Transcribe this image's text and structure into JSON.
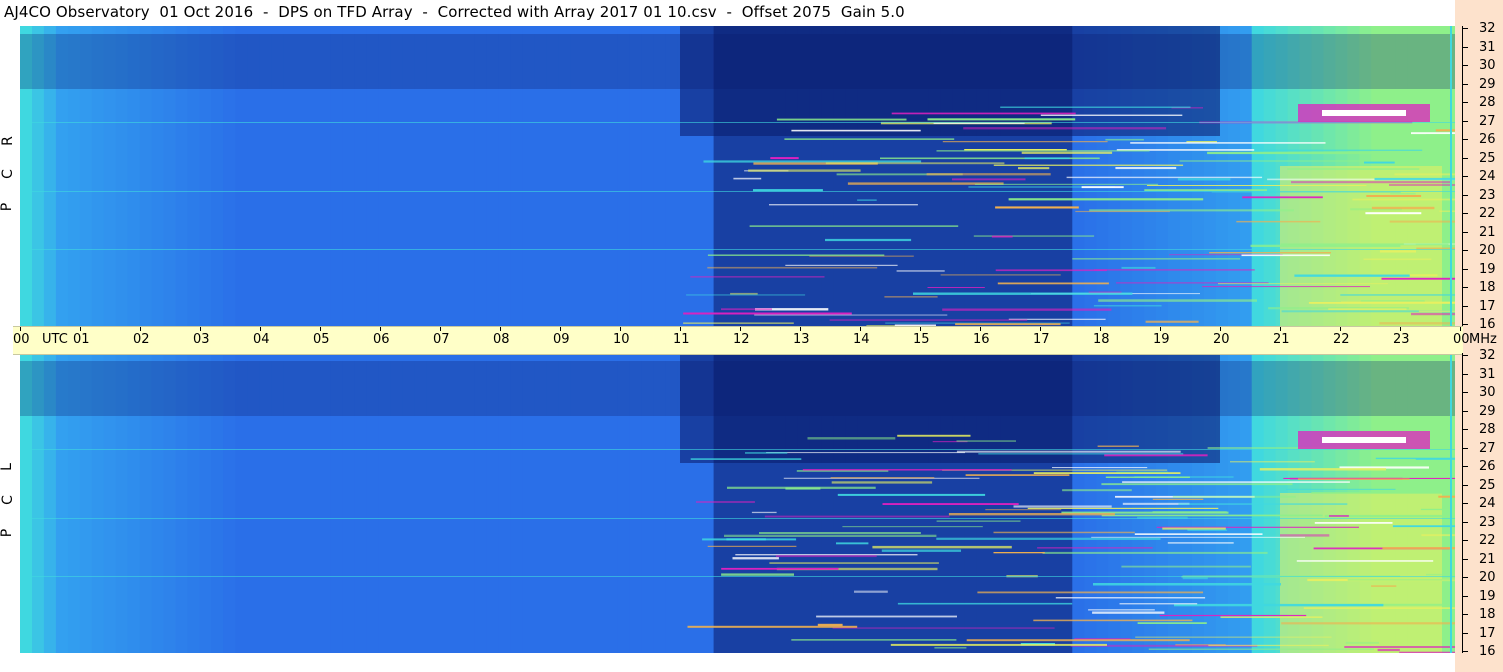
{
  "title": "AJ4CO Observatory  01 Oct 2016  -  DPS on TFD Array  -  Corrected with Array 2017 01 10.csv  -  Offset 2075  Gain 5.0",
  "panels": {
    "top_label": [
      "R",
      "C",
      "P"
    ],
    "bottom_label": [
      "L",
      "C",
      "P"
    ]
  },
  "time_axis": {
    "labels": [
      "00",
      "01",
      "02",
      "03",
      "04",
      "05",
      "06",
      "07",
      "08",
      "09",
      "10",
      "11",
      "12",
      "13",
      "14",
      "15",
      "16",
      "17",
      "18",
      "19",
      "20",
      "21",
      "22",
      "23",
      "00"
    ],
    "utc_label": "UTC",
    "mhz_label": "MHz"
  },
  "freq_axis": {
    "labels": [
      "32",
      "31",
      "30",
      "29",
      "28",
      "27",
      "26",
      "25",
      "24",
      "23",
      "22",
      "21",
      "20",
      "19",
      "18",
      "17",
      "16"
    ]
  },
  "colors": {
    "background_low": "#2a6fe8",
    "dark": "#0a1a6a",
    "mid": "#33a0f0",
    "cyan": "#3fd8e0",
    "green": "#8ef08a",
    "yellow": "#e8f060",
    "orange": "#f0b050",
    "magenta": "#e020c0",
    "white": "#ffffff",
    "time_bar": "#ffffc8",
    "freq_bar": "#fde2cc"
  },
  "chart_data": {
    "type": "heatmap",
    "title": "AJ4CO Observatory  01 Oct 2016  -  DPS on TFD Array  -  Corrected with Array 2017 01 10.csv  -  Offset 2075  Gain 5.0",
    "x_unit": "UTC",
    "y_unit": "MHz",
    "xlim": [
      0,
      24
    ],
    "ylim": [
      16,
      32
    ],
    "x_ticks": [
      "00",
      "01",
      "02",
      "03",
      "04",
      "05",
      "06",
      "07",
      "08",
      "09",
      "10",
      "11",
      "12",
      "13",
      "14",
      "15",
      "16",
      "17",
      "18",
      "19",
      "20",
      "21",
      "22",
      "23",
      "00"
    ],
    "y_ticks": [
      32,
      31,
      30,
      29,
      28,
      27,
      26,
      25,
      24,
      23,
      22,
      21,
      20,
      19,
      18,
      17,
      16
    ],
    "panels": [
      "R C P",
      "L C P"
    ],
    "features": [
      {
        "kind": "quiet_low_power",
        "x_range": [
          0.5,
          11
        ],
        "level": "low"
      },
      {
        "kind": "dark_minimum",
        "x_range": [
          12,
          17.5
        ],
        "level": "very_low"
      },
      {
        "kind": "rfi_band_activity",
        "x_range": [
          11,
          24
        ],
        "level": "high"
      },
      {
        "kind": "strong_interference",
        "x_range": [
          21,
          23.5
        ],
        "y_range": [
          26.5,
          28.3
        ],
        "level": "saturated"
      },
      {
        "kind": "daytime_rise",
        "x_range": [
          20,
          24
        ],
        "level": "elevated"
      }
    ]
  }
}
